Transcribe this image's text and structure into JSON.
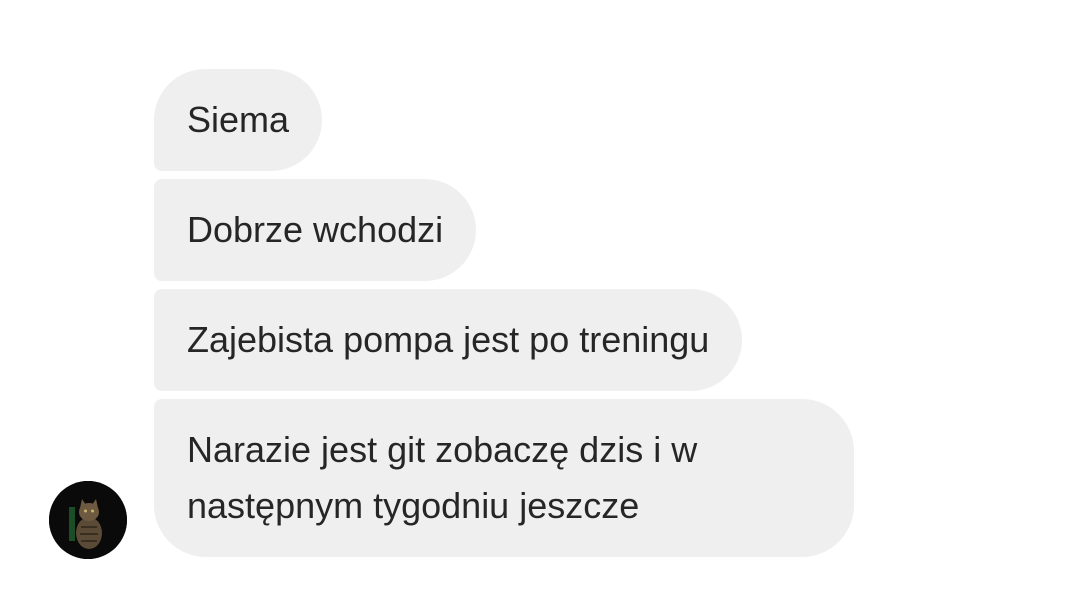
{
  "messages": [
    {
      "text": "Siema"
    },
    {
      "text": "Dobrze wchodzi"
    },
    {
      "text": "Zajebista pompa jest po treningu"
    },
    {
      "text": "Narazie jest git zobaczę dzis i w następnym tygodniu jeszcze"
    }
  ],
  "sender": {
    "avatar_icon": "cat-avatar-icon"
  },
  "colors": {
    "bubble_bg": "#efefef",
    "text": "#262626",
    "background": "#ffffff"
  }
}
